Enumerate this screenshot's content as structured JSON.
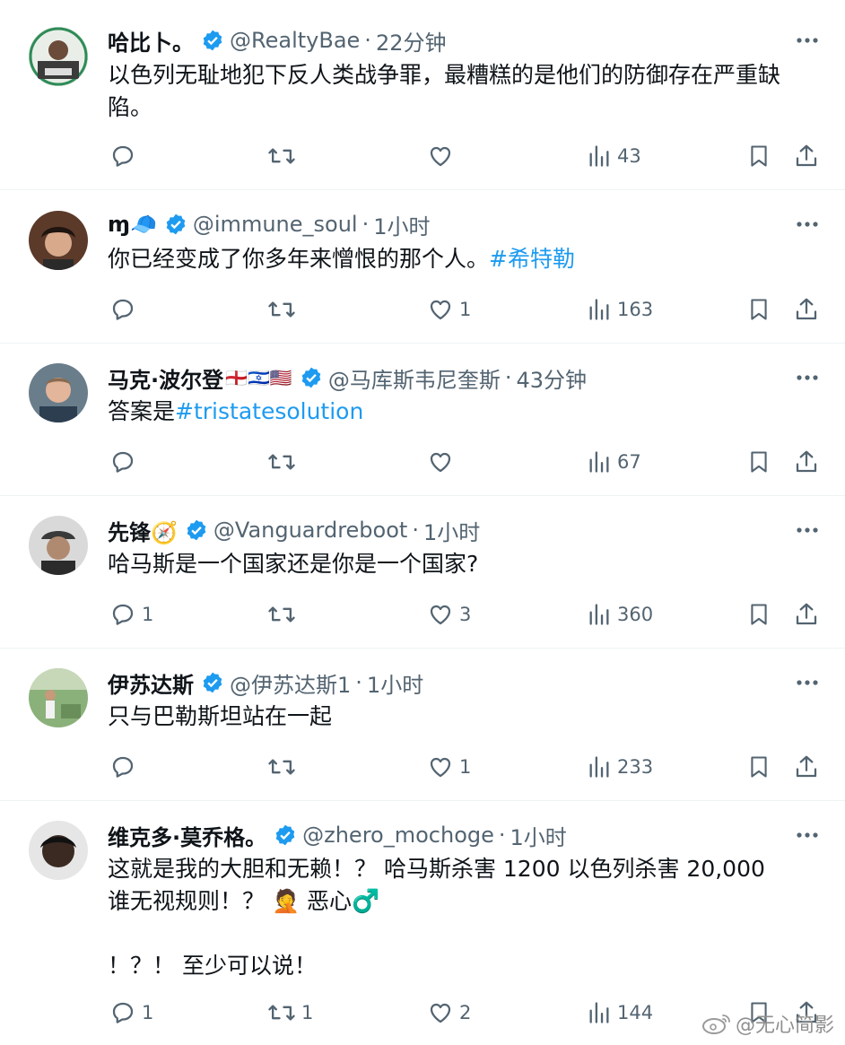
{
  "tweets": [
    {
      "name": "哈比卜。",
      "handle": "@RealtyBae",
      "time": "22分钟",
      "text": "以色列无耻地犯下反人类战争罪，最糟糕的是他们的防御存在严重缺陷。",
      "hashtag": "",
      "replies": "",
      "retweets": "",
      "likes": "",
      "views": "43"
    },
    {
      "name": "ɱ🧢",
      "handle": "@immune_soul",
      "time": "1小时",
      "text": "你已经变成了你多年来憎恨的那个人。",
      "hashtag": "#希特勒",
      "replies": "",
      "retweets": "",
      "likes": "1",
      "views": "163"
    },
    {
      "name": "马克·波尔登",
      "flags": "🏴󠁧󠁢󠁥󠁮󠁧󠁿🇮🇱🇺🇸",
      "handle": "@马库斯韦尼奎斯",
      "time": "43分钟",
      "text": "答案是",
      "hashtag": "#tristatesolution",
      "replies": "",
      "retweets": "",
      "likes": "",
      "views": "67"
    },
    {
      "name": "先锋🧭",
      "handle": "@Vanguardreboot",
      "time": "1小时",
      "text": "哈马斯是一个国家还是你是一个国家?",
      "hashtag": "",
      "replies": "1",
      "retweets": "",
      "likes": "3",
      "views": "360"
    },
    {
      "name": "伊苏达斯",
      "handle": "@伊苏达斯1",
      "time": "1小时",
      "text": "只与巴勒斯坦站在一起",
      "hashtag": "",
      "replies": "",
      "retweets": "",
      "likes": "1",
      "views": "233"
    },
    {
      "name": "维克多·莫乔格。",
      "handle": "@zhero_mochoge",
      "time": "1小时",
      "text": "这就是我的大胆和无赖！？ 哈马斯杀害 1200 以色列杀害 20,000\n谁无视规则！？ 🤦 恶心♂️\n\n！？！ 至少可以说！",
      "hashtag": "",
      "replies": "1",
      "retweets": "1",
      "likes": "2",
      "views": "144"
    }
  ],
  "watermark": "@无心简影",
  "colors": {
    "accent": "#1d9bf0",
    "muted": "#536471",
    "text": "#0f1419"
  }
}
